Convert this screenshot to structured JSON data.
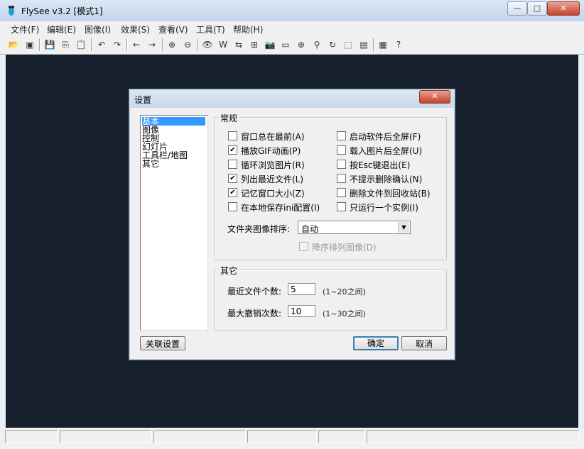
{
  "window": {
    "title": "FlySee v3.2 [模式1]",
    "minimize": "—",
    "maximize": "□",
    "close": "✕"
  },
  "menu": [
    "文件(F)",
    "编辑(E)",
    "图像(I)",
    "效果(S)",
    "查看(V)",
    "工具(T)",
    "帮助(H)"
  ],
  "toolbar": [
    {
      "icon": "open-folder-icon",
      "glyph": "📂"
    },
    {
      "icon": "browse-icon",
      "glyph": "▣"
    },
    {
      "icon": "save-icon",
      "glyph": "💾"
    },
    {
      "icon": "copy-icon",
      "glyph": "⎘"
    },
    {
      "icon": "paste-icon",
      "glyph": "📋"
    },
    {
      "icon": "undo-icon",
      "glyph": "↶"
    },
    {
      "icon": "redo-icon",
      "glyph": "↷"
    },
    {
      "icon": "prev-icon",
      "glyph": "←"
    },
    {
      "icon": "next-icon",
      "glyph": "→"
    },
    {
      "icon": "zoom-in-icon",
      "glyph": "⊕"
    },
    {
      "icon": "zoom-out-icon",
      "glyph": "⊖"
    },
    {
      "icon": "view-icon",
      "glyph": "👁"
    },
    {
      "icon": "wallpaper-icon",
      "glyph": "W"
    },
    {
      "icon": "rotate-icon",
      "glyph": "⇆"
    },
    {
      "icon": "resize-icon",
      "glyph": "⊞"
    },
    {
      "icon": "camera-icon",
      "glyph": "📷"
    },
    {
      "icon": "capture-icon",
      "glyph": "▭"
    },
    {
      "icon": "target-icon",
      "glyph": "⊕"
    },
    {
      "icon": "filter-icon",
      "glyph": "⚲"
    },
    {
      "icon": "refresh-icon",
      "glyph": "↻"
    },
    {
      "icon": "select-icon",
      "glyph": "⬚"
    },
    {
      "icon": "portrait-icon",
      "glyph": "▤"
    },
    {
      "icon": "calculator-icon",
      "glyph": "▦"
    },
    {
      "icon": "help-icon",
      "glyph": "?"
    }
  ],
  "dialog": {
    "title": "设置",
    "close": "✕",
    "nav": [
      "基本",
      "图像",
      "控制",
      "幻灯片",
      "工具栏/地图",
      "其它"
    ],
    "general": {
      "label": "常规",
      "left": [
        {
          "label": "窗口总在最前(A)",
          "checked": false
        },
        {
          "label": "播放GIF动画(P)",
          "checked": true
        },
        {
          "label": "循环浏览图片(R)",
          "checked": false
        },
        {
          "label": "列出最近文件(L)",
          "checked": true
        },
        {
          "label": "记忆窗口大小(Z)",
          "checked": true
        },
        {
          "label": "在本地保存ini配置(I)",
          "checked": false
        }
      ],
      "right": [
        {
          "label": "启动软件后全屏(F)",
          "checked": false
        },
        {
          "label": "载入图片后全屏(U)",
          "checked": false
        },
        {
          "label": "按Esc键退出(E)",
          "checked": false
        },
        {
          "label": "不提示删除确认(N)",
          "checked": false
        },
        {
          "label": "删除文件到回收站(B)",
          "checked": false
        },
        {
          "label": "只运行一个实例(I)",
          "checked": false
        }
      ],
      "sort_label": "文件夹图像排序:",
      "sort_value": "自动",
      "desc_label": "降序排列图像(D)",
      "check_mark": "✔"
    },
    "other": {
      "label": "其它",
      "recent_label": "最近文件个数:",
      "recent_value": "5",
      "recent_hint": "(1~20之间)",
      "undo_label": "最大撤销次数:",
      "undo_value": "10",
      "undo_hint": "(1~30之间)"
    },
    "assoc_button": "关联设置",
    "ok_button": "确定",
    "cancel_button": "取消"
  }
}
